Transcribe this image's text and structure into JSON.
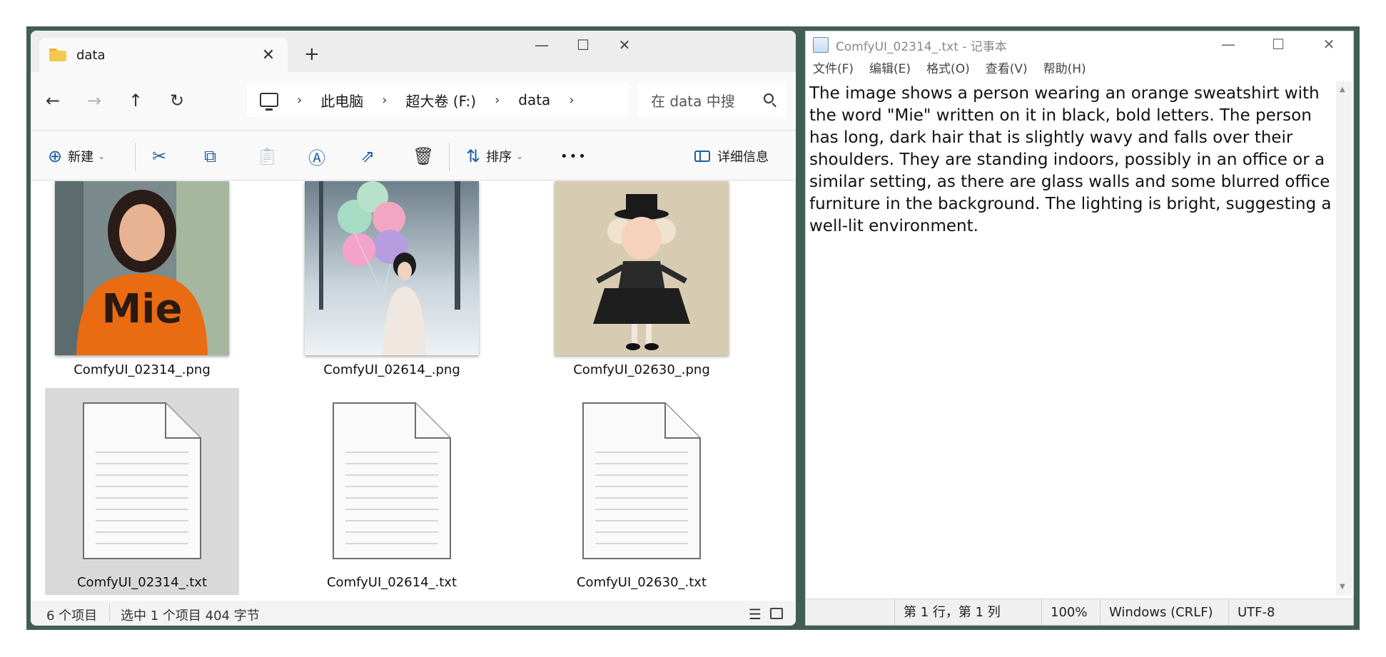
{
  "explorer": {
    "tab_title": "data",
    "tab_close": "✕",
    "new_tab": "+",
    "window_controls": {
      "minimize": "—",
      "maximize": "☐",
      "close": "✕"
    },
    "nav": {
      "back": "←",
      "forward": "→",
      "up": "↑",
      "refresh": "↻"
    },
    "breadcrumb": [
      "此电脑",
      "超大卷 (F:)",
      "data"
    ],
    "breadcrumb_sep": "›",
    "search_placeholder": "在 data 中搜",
    "toolbar": {
      "new_label": "新建",
      "sort_label": "排序",
      "more": "•••",
      "details_label": "详细信息"
    },
    "files": [
      {
        "name": "ComfyUI_02314_.png",
        "kind": "image"
      },
      {
        "name": "ComfyUI_02614_.png",
        "kind": "image"
      },
      {
        "name": "ComfyUI_02630_.png",
        "kind": "image"
      },
      {
        "name": "ComfyUI_02314_.txt",
        "kind": "text",
        "selected": true
      },
      {
        "name": "ComfyUI_02614_.txt",
        "kind": "text"
      },
      {
        "name": "ComfyUI_02630_.txt",
        "kind": "text"
      }
    ],
    "thumb_text": "Mie",
    "status": {
      "count": "6 个项目",
      "selection": "选中 1 个项目  404 字节"
    }
  },
  "notepad": {
    "title": "ComfyUI_02314_.txt - 记事本",
    "window_controls": {
      "minimize": "—",
      "maximize": "☐",
      "close": "✕"
    },
    "menu": [
      "文件(F)",
      "编辑(E)",
      "格式(O)",
      "查看(V)",
      "帮助(H)"
    ],
    "text": "The image shows a person wearing an orange sweatshirt with\nthe word \"Mie\" written on it in black, bold letters. The person\nhas long, dark hair that is slightly wavy and falls over their\nshoulders. They are standing indoors, possibly in an office or a\nsimilar setting, as there are glass walls and some blurred office\nfurniture in the background. The lighting is bright, suggesting a\nwell-lit environment.",
    "status": {
      "position": "第 1 行，第 1 列",
      "zoom": "100%",
      "line_ending": "Windows (CRLF)",
      "encoding": "UTF-8"
    }
  },
  "colors": {
    "desktop": "#3f5f55",
    "accent": "#1f5fa8",
    "sweatshirt": "#e96b12"
  }
}
